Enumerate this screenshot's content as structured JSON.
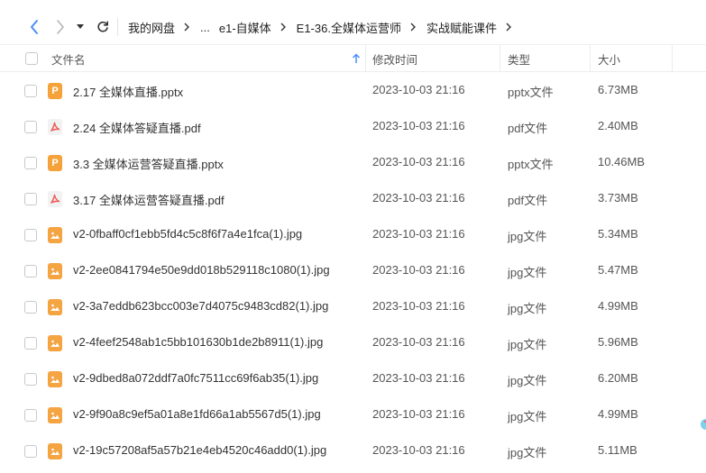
{
  "breadcrumb": {
    "items": [
      "我的网盘",
      "...",
      "e1-自媒体",
      "E1-36.全媒体运营师",
      "实战赋能课件"
    ]
  },
  "table": {
    "headers": {
      "name": "文件名",
      "date": "修改时间",
      "type": "类型",
      "size": "大小"
    },
    "sort": "name-ascending",
    "rows": [
      {
        "icon": "ppt-file-icon",
        "name": "2.17 全媒体直播.pptx",
        "date": "2023-10-03 21:16",
        "type": "pptx文件",
        "size": "6.73MB"
      },
      {
        "icon": "pdf-file-icon",
        "name": "2.24 全媒体答疑直播.pdf",
        "date": "2023-10-03 21:16",
        "type": "pdf文件",
        "size": "2.40MB"
      },
      {
        "icon": "ppt-file-icon",
        "name": "3.3 全媒体运营答疑直播.pptx",
        "date": "2023-10-03 21:16",
        "type": "pptx文件",
        "size": "10.46MB"
      },
      {
        "icon": "pdf-file-icon",
        "name": "3.17 全媒体运营答疑直播.pdf",
        "date": "2023-10-03 21:16",
        "type": "pdf文件",
        "size": "3.73MB"
      },
      {
        "icon": "image-file-icon",
        "name": "v2-0fbaff0cf1ebb5fd4c5c8f6f7a4e1fca(1).jpg",
        "date": "2023-10-03 21:16",
        "type": "jpg文件",
        "size": "5.34MB"
      },
      {
        "icon": "image-file-icon",
        "name": "v2-2ee0841794e50e9dd018b529118c1080(1).jpg",
        "date": "2023-10-03 21:16",
        "type": "jpg文件",
        "size": "5.47MB"
      },
      {
        "icon": "image-file-icon",
        "name": "v2-3a7eddb623bcc003e7d4075c9483cd82(1).jpg",
        "date": "2023-10-03 21:16",
        "type": "jpg文件",
        "size": "4.99MB"
      },
      {
        "icon": "image-file-icon",
        "name": "v2-4feef2548ab1c5bb101630b1de2b8911(1).jpg",
        "date": "2023-10-03 21:16",
        "type": "jpg文件",
        "size": "5.96MB"
      },
      {
        "icon": "image-file-icon",
        "name": "v2-9dbed8a072ddf7a0fc7511cc69f6ab35(1).jpg",
        "date": "2023-10-03 21:16",
        "type": "jpg文件",
        "size": "6.20MB"
      },
      {
        "icon": "image-file-icon",
        "name": "v2-9f90a8c9ef5a01a8e1fd66a1ab5567d5(1).jpg",
        "date": "2023-10-03 21:16",
        "type": "jpg文件",
        "size": "4.99MB"
      },
      {
        "icon": "image-file-icon",
        "name": "v2-19c57208af5a57b21e4eb4520c46add0(1).jpg",
        "date": "2023-10-03 21:16",
        "type": "jpg文件",
        "size": "5.11MB"
      }
    ]
  },
  "colors": {
    "accent": "#4a8df7",
    "ppt_icon": "#f5a23a",
    "pdf_icon": "#f05a5a",
    "image_icon": "#f5a442"
  }
}
